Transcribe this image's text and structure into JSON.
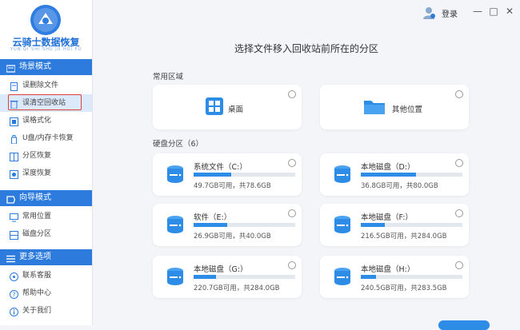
{
  "app": {
    "name": "云骑士数据恢复",
    "subtitle": "YUN QI SHI SHU JU HUI FU"
  },
  "sidebar": {
    "sections": [
      {
        "title": "场景模式",
        "items": [
          "误删除文件",
          "误清空回收站",
          "误格式化",
          "U盘/内存卡恢复",
          "分区恢复",
          "深度恢复"
        ]
      },
      {
        "title": "向导模式",
        "items": [
          "常用位置",
          "磁盘分区"
        ]
      },
      {
        "title": "更多选项",
        "items": [
          "联系客服",
          "帮助中心",
          "关于我们"
        ]
      }
    ],
    "active_item": "误清空回收站"
  },
  "titlebar": {
    "login": "登录",
    "minimize": "—",
    "maximize": "□",
    "close": "✕"
  },
  "main": {
    "title": "选择文件移入回收站前所在的分区",
    "common_label": "常用区域",
    "locations": [
      {
        "label": "桌面",
        "icon": "windows-icon"
      },
      {
        "label": "其他位置",
        "icon": "folder-icon"
      }
    ],
    "disk_label": "硬盘分区（6）",
    "drives": [
      {
        "name": "系统文件（C:）",
        "capacity": "49.7GB可用，共78.6GB",
        "used_fraction": 0.37
      },
      {
        "name": "本地磁盘（D:）",
        "capacity": "36.8GB可用，共80.0GB",
        "used_fraction": 0.54
      },
      {
        "name": "软件（E:）",
        "capacity": "26.9GB可用，共40.0GB",
        "used_fraction": 0.33
      },
      {
        "name": "本地磁盘（F:）",
        "capacity": "216.5GB可用，共284.0GB",
        "used_fraction": 0.24
      },
      {
        "name": "本地磁盘（G:）",
        "capacity": "220.7GB可用，共284.0GB",
        "used_fraction": 0.22
      },
      {
        "name": "本地磁盘（H:）",
        "capacity": "240.5GB可用，共283.5GB",
        "used_fraction": 0.15
      }
    ]
  },
  "colors": {
    "accent": "#2d7bdd",
    "highlight": "#e0403a",
    "bar": "#2d8ce6"
  }
}
